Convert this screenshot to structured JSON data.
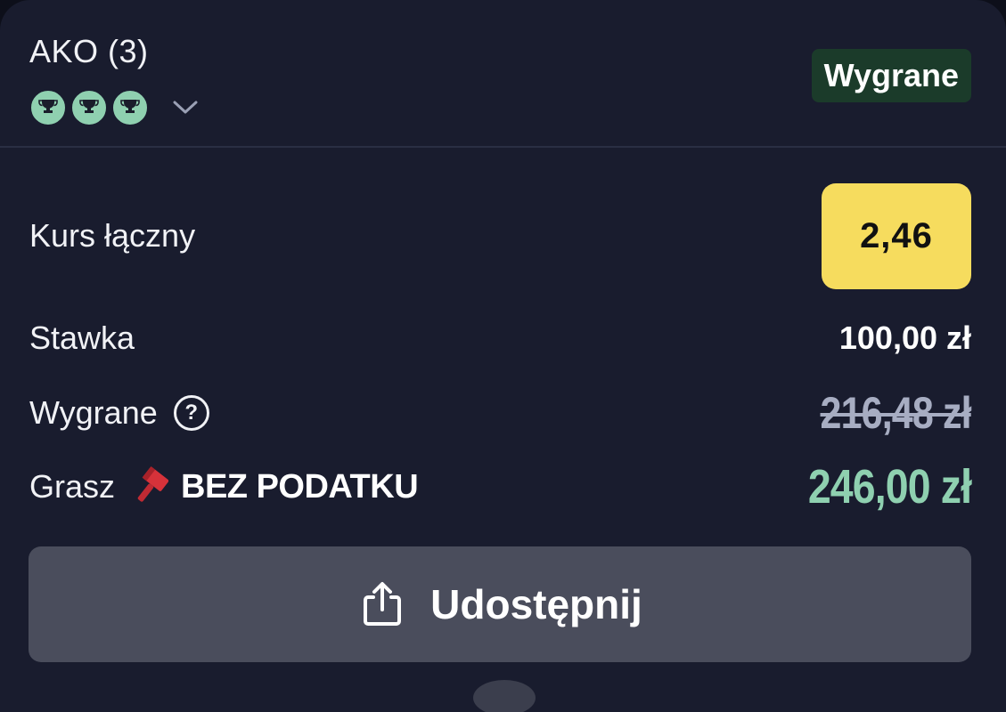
{
  "header": {
    "bet_type": "AKO (3)",
    "status": "Wygrane",
    "trophy_count": 3,
    "trophy_icon": "trophy-icon",
    "expand_icon": "chevron-down-icon"
  },
  "summary": {
    "odds_label": "Kurs łączny",
    "odds_value": "2,46",
    "stake_label": "Stawka",
    "stake_value": "100,00 zł",
    "winnings_label": "Wygrane",
    "winnings_original": "216,48 zł",
    "promo_prefix": "Grasz",
    "promo_name": "BEZ PODATKU",
    "promo_icon": "hammer-icon",
    "promo_winnings": "246,00 zł"
  },
  "actions": {
    "share_label": "Udostępnij",
    "share_icon": "share-icon"
  },
  "colors": {
    "background": "#191c2e",
    "accent_yellow": "#f6dc5e",
    "accent_green": "#8fd0b0",
    "badge_green": "#1b3b2a",
    "button_gray": "#4a4d5c",
    "strike_gray": "#a7adc2"
  }
}
